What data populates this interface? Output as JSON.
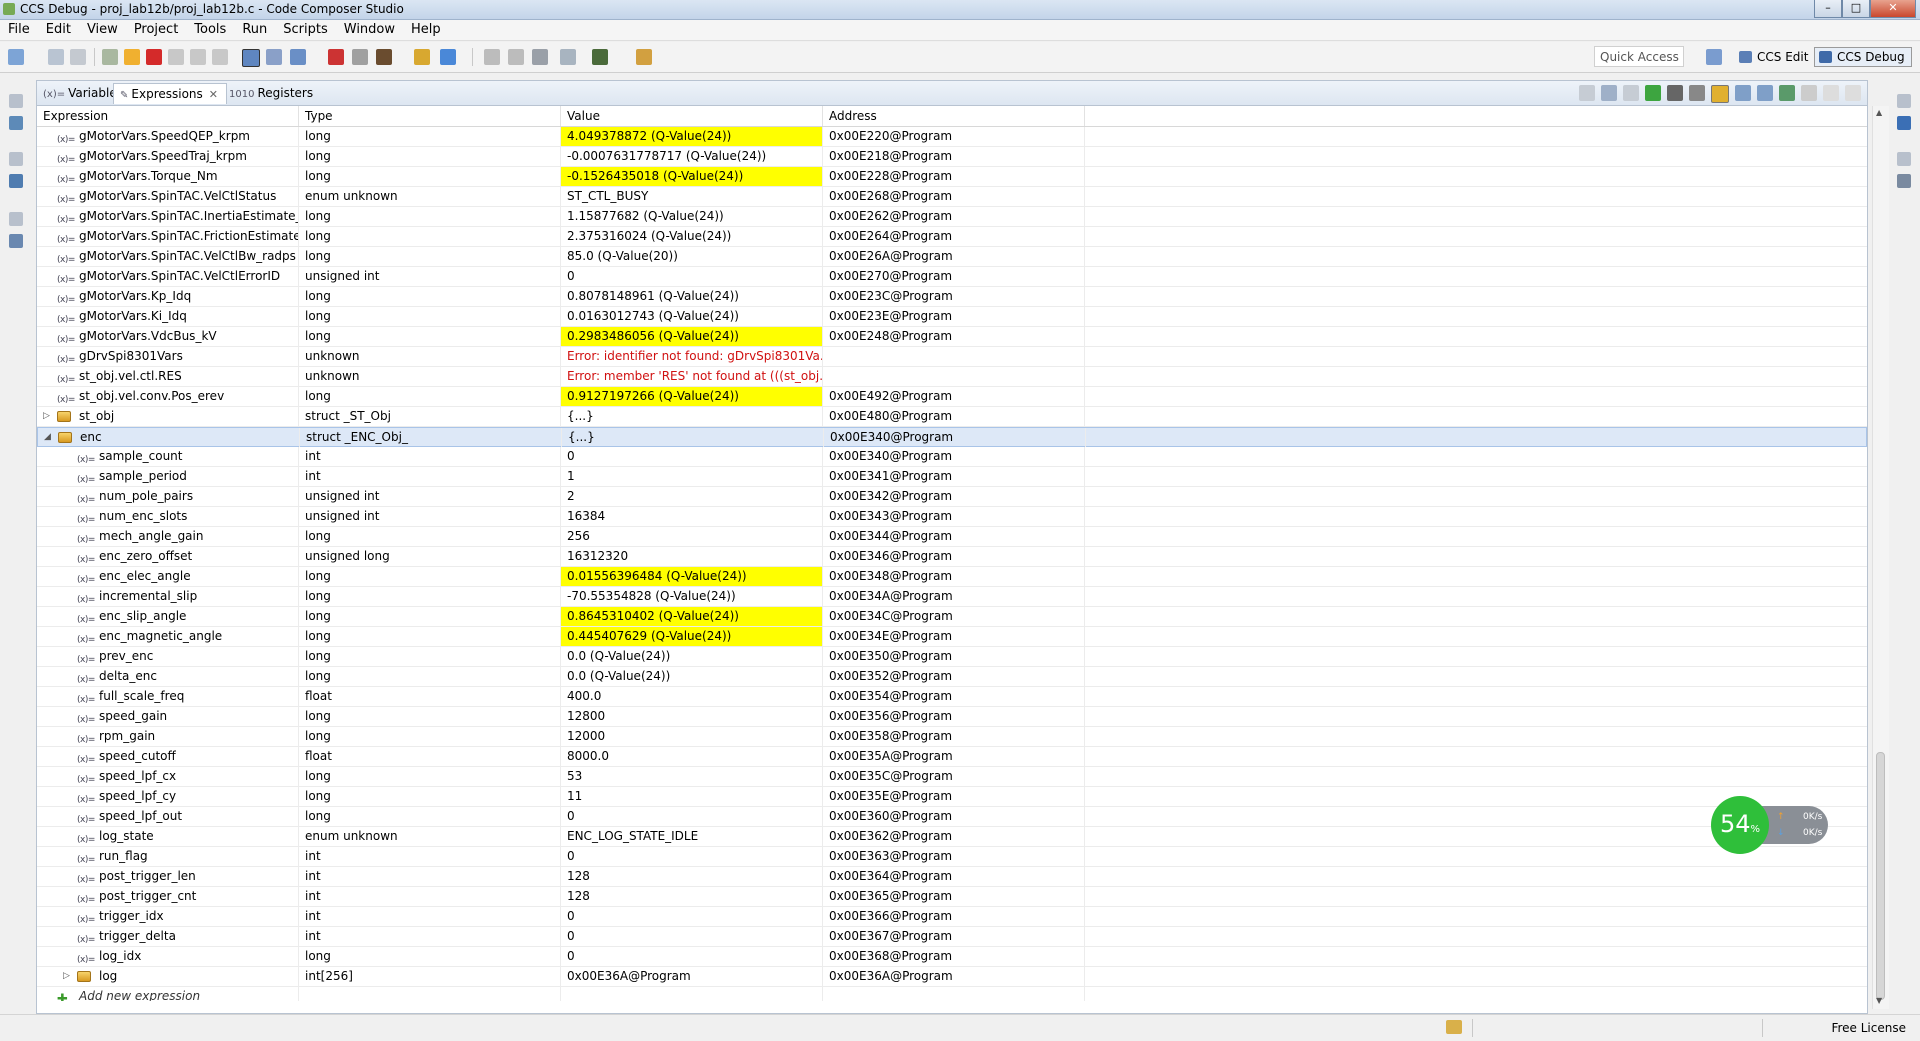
{
  "window": {
    "title": "CCS Debug - proj_lab12b/proj_lab12b.c - Code Composer Studio",
    "min_glyph": "–",
    "max_glyph": "□",
    "close_glyph": "✕"
  },
  "menu": [
    "File",
    "Edit",
    "View",
    "Project",
    "Tools",
    "Run",
    "Scripts",
    "Window",
    "Help"
  ],
  "toolbar": {
    "quick_access_placeholder": "Quick Access",
    "perspectives": [
      {
        "label": "CCS Edit",
        "active": false
      },
      {
        "label": "CCS Debug",
        "active": true
      }
    ]
  },
  "view": {
    "tabs": [
      {
        "icon": "(x)=",
        "label": "Variables",
        "active": false
      },
      {
        "icon": "✎",
        "label": "Expressions",
        "active": true,
        "close": "✕"
      },
      {
        "icon": "1010",
        "label": "Registers",
        "active": false
      }
    ],
    "columns": [
      "Expression",
      "Type",
      "Value",
      "Address"
    ]
  },
  "rows": [
    {
      "level": 0,
      "expander": "",
      "icon": "var",
      "expression": "gMotorVars.SpeedQEP_krpm",
      "type": "long",
      "value": "4.049378872 (Q-Value(24))",
      "address": "0x00E220@Program",
      "highlight": true
    },
    {
      "level": 0,
      "expander": "",
      "icon": "var",
      "expression": "gMotorVars.SpeedTraj_krpm",
      "type": "long",
      "value": "-0.0007631778717 (Q-Value(24))",
      "address": "0x00E218@Program"
    },
    {
      "level": 0,
      "expander": "",
      "icon": "var",
      "expression": "gMotorVars.Torque_Nm",
      "type": "long",
      "value": "-0.1526435018 (Q-Value(24))",
      "address": "0x00E228@Program",
      "highlight": true
    },
    {
      "level": 0,
      "expander": "",
      "icon": "var",
      "expression": "gMotorVars.SpinTAC.VelCtlStatus",
      "type": "enum unknown",
      "value": "ST_CTL_BUSY",
      "address": "0x00E268@Program"
    },
    {
      "level": 0,
      "expander": "",
      "icon": "var",
      "expression": "gMotorVars.SpinTAC.InertiaEstimate_",
      "type": "long",
      "value": "1.15877682 (Q-Value(24))",
      "address": "0x00E262@Program"
    },
    {
      "level": 0,
      "expander": "",
      "icon": "var",
      "expression": "gMotorVars.SpinTAC.FrictionEstimate",
      "type": "long",
      "value": "2.375316024 (Q-Value(24))",
      "address": "0x00E264@Program"
    },
    {
      "level": 0,
      "expander": "",
      "icon": "var",
      "expression": "gMotorVars.SpinTAC.VelCtlBw_radps",
      "type": "long",
      "value": "85.0 (Q-Value(20))",
      "address": "0x00E26A@Program"
    },
    {
      "level": 0,
      "expander": "",
      "icon": "var",
      "expression": "gMotorVars.SpinTAC.VelCtlErrorID",
      "type": "unsigned int",
      "value": "0",
      "address": "0x00E270@Program"
    },
    {
      "level": 0,
      "expander": "",
      "icon": "var",
      "expression": "gMotorVars.Kp_Idq",
      "type": "long",
      "value": "0.8078148961 (Q-Value(24))",
      "address": "0x00E23C@Program"
    },
    {
      "level": 0,
      "expander": "",
      "icon": "var",
      "expression": "gMotorVars.Ki_Idq",
      "type": "long",
      "value": "0.0163012743 (Q-Value(24))",
      "address": "0x00E23E@Program"
    },
    {
      "level": 0,
      "expander": "",
      "icon": "var",
      "expression": "gMotorVars.VdcBus_kV",
      "type": "long",
      "value": "0.2983486056 (Q-Value(24))",
      "address": "0x00E248@Program",
      "highlight": true
    },
    {
      "level": 0,
      "expander": "",
      "icon": "var",
      "expression": "gDrvSpi8301Vars",
      "type": "unknown",
      "value": "Error: identifier not found: gDrvSpi8301Va...",
      "address": "",
      "error": true
    },
    {
      "level": 0,
      "expander": "",
      "icon": "var",
      "expression": "st_obj.vel.ctl.RES",
      "type": "unknown",
      "value": "Error: member 'RES' not found at (((st_obj...",
      "address": "",
      "error": true
    },
    {
      "level": 0,
      "expander": "",
      "icon": "var",
      "expression": "st_obj.vel.conv.Pos_erev",
      "type": "long",
      "value": "0.9127197266 (Q-Value(24))",
      "address": "0x00E492@Program",
      "highlight": true
    },
    {
      "level": 0,
      "expander": "▷",
      "icon": "struct",
      "expression": "st_obj",
      "type": "struct _ST_Obj",
      "value": "{...}",
      "address": "0x00E480@Program"
    },
    {
      "level": 0,
      "expander": "◢",
      "icon": "struct",
      "expression": "enc",
      "type": "struct _ENC_Obj_",
      "value": "{...}",
      "address": "0x00E340@Program",
      "selected": true
    },
    {
      "level": 1,
      "expander": "",
      "icon": "var",
      "expression": "sample_count",
      "type": "int",
      "value": "0",
      "address": "0x00E340@Program"
    },
    {
      "level": 1,
      "expander": "",
      "icon": "var",
      "expression": "sample_period",
      "type": "int",
      "value": "1",
      "address": "0x00E341@Program"
    },
    {
      "level": 1,
      "expander": "",
      "icon": "var",
      "expression": "num_pole_pairs",
      "type": "unsigned int",
      "value": "2",
      "address": "0x00E342@Program"
    },
    {
      "level": 1,
      "expander": "",
      "icon": "var",
      "expression": "num_enc_slots",
      "type": "unsigned int",
      "value": "16384",
      "address": "0x00E343@Program"
    },
    {
      "level": 1,
      "expander": "",
      "icon": "var",
      "expression": "mech_angle_gain",
      "type": "long",
      "value": "256",
      "address": "0x00E344@Program"
    },
    {
      "level": 1,
      "expander": "",
      "icon": "var",
      "expression": "enc_zero_offset",
      "type": "unsigned long",
      "value": "16312320",
      "address": "0x00E346@Program"
    },
    {
      "level": 1,
      "expander": "",
      "icon": "var",
      "expression": "enc_elec_angle",
      "type": "long",
      "value": "0.01556396484 (Q-Value(24))",
      "address": "0x00E348@Program",
      "highlight": true
    },
    {
      "level": 1,
      "expander": "",
      "icon": "var",
      "expression": "incremental_slip",
      "type": "long",
      "value": "-70.55354828 (Q-Value(24))",
      "address": "0x00E34A@Program"
    },
    {
      "level": 1,
      "expander": "",
      "icon": "var",
      "expression": "enc_slip_angle",
      "type": "long",
      "value": "0.8645310402 (Q-Value(24))",
      "address": "0x00E34C@Program",
      "highlight": true
    },
    {
      "level": 1,
      "expander": "",
      "icon": "var",
      "expression": "enc_magnetic_angle",
      "type": "long",
      "value": "0.445407629 (Q-Value(24))",
      "address": "0x00E34E@Program",
      "highlight": true
    },
    {
      "level": 1,
      "expander": "",
      "icon": "var",
      "expression": "prev_enc",
      "type": "long",
      "value": "0.0 (Q-Value(24))",
      "address": "0x00E350@Program"
    },
    {
      "level": 1,
      "expander": "",
      "icon": "var",
      "expression": "delta_enc",
      "type": "long",
      "value": "0.0 (Q-Value(24))",
      "address": "0x00E352@Program"
    },
    {
      "level": 1,
      "expander": "",
      "icon": "var",
      "expression": "full_scale_freq",
      "type": "float",
      "value": "400.0",
      "address": "0x00E354@Program"
    },
    {
      "level": 1,
      "expander": "",
      "icon": "var",
      "expression": "speed_gain",
      "type": "long",
      "value": "12800",
      "address": "0x00E356@Program"
    },
    {
      "level": 1,
      "expander": "",
      "icon": "var",
      "expression": "rpm_gain",
      "type": "long",
      "value": "12000",
      "address": "0x00E358@Program"
    },
    {
      "level": 1,
      "expander": "",
      "icon": "var",
      "expression": "speed_cutoff",
      "type": "float",
      "value": "8000.0",
      "address": "0x00E35A@Program"
    },
    {
      "level": 1,
      "expander": "",
      "icon": "var",
      "expression": "speed_lpf_cx",
      "type": "long",
      "value": "53",
      "address": "0x00E35C@Program"
    },
    {
      "level": 1,
      "expander": "",
      "icon": "var",
      "expression": "speed_lpf_cy",
      "type": "long",
      "value": "11",
      "address": "0x00E35E@Program"
    },
    {
      "level": 1,
      "expander": "",
      "icon": "var",
      "expression": "speed_lpf_out",
      "type": "long",
      "value": "0",
      "address": "0x00E360@Program"
    },
    {
      "level": 1,
      "expander": "",
      "icon": "var",
      "expression": "log_state",
      "type": "enum unknown",
      "value": "ENC_LOG_STATE_IDLE",
      "address": "0x00E362@Program"
    },
    {
      "level": 1,
      "expander": "",
      "icon": "var",
      "expression": "run_flag",
      "type": "int",
      "value": "0",
      "address": "0x00E363@Program"
    },
    {
      "level": 1,
      "expander": "",
      "icon": "var",
      "expression": "post_trigger_len",
      "type": "int",
      "value": "128",
      "address": "0x00E364@Program"
    },
    {
      "level": 1,
      "expander": "",
      "icon": "var",
      "expression": "post_trigger_cnt",
      "type": "int",
      "value": "128",
      "address": "0x00E365@Program"
    },
    {
      "level": 1,
      "expander": "",
      "icon": "var",
      "expression": "trigger_idx",
      "type": "int",
      "value": "0",
      "address": "0x00E366@Program"
    },
    {
      "level": 1,
      "expander": "",
      "icon": "var",
      "expression": "trigger_delta",
      "type": "int",
      "value": "0",
      "address": "0x00E367@Program"
    },
    {
      "level": 1,
      "expander": "",
      "icon": "var",
      "expression": "log_idx",
      "type": "long",
      "value": "0",
      "address": "0x00E368@Program"
    },
    {
      "level": 1,
      "expander": "▷",
      "icon": "struct",
      "expression": "log",
      "type": "int[256]",
      "value": "0x00E36A@Program",
      "address": "0x00E36A@Program"
    },
    {
      "level": 0,
      "expander": "",
      "icon": "add",
      "expression": "Add new expression",
      "type": "",
      "value": "",
      "address": "",
      "add": true
    }
  ],
  "widget": {
    "percent": "54",
    "percent_sign": "%",
    "up": "0K/s",
    "down": "0K/s",
    "up_arrow": "↑",
    "down_arrow": "↓"
  },
  "status": {
    "license": "Free License"
  },
  "colors": {
    "highlight": "#ffff00",
    "error": "#d01010",
    "selection": "#dde8f7",
    "widget_green": "#2fbf3a"
  }
}
